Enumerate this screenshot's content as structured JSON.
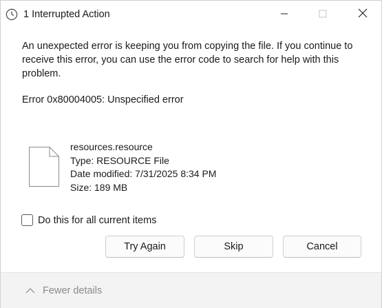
{
  "window": {
    "title": "1 Interrupted Action",
    "icons": {
      "app": "clock-icon",
      "minimize": "minimize-icon",
      "maximize": "maximize-icon",
      "close": "close-icon"
    }
  },
  "message": "An unexpected error is keeping you from copying the file. If you continue to receive this error, you can use the error code to search for help with this problem.",
  "error_code": "Error 0x80004005: Unspecified error",
  "file": {
    "icon": "document-icon",
    "name": "resources.resource",
    "type": "Type: RESOURCE File",
    "date_modified": "Date modified: 7/31/2025 8:34 PM",
    "size": "Size: 189 MB"
  },
  "checkbox": {
    "label": "Do this for all current items",
    "checked": false
  },
  "buttons": {
    "try_again": "Try Again",
    "skip": "Skip",
    "cancel": "Cancel"
  },
  "footer": {
    "toggle_label": "Fewer details",
    "icon": "chevron-up-icon"
  }
}
